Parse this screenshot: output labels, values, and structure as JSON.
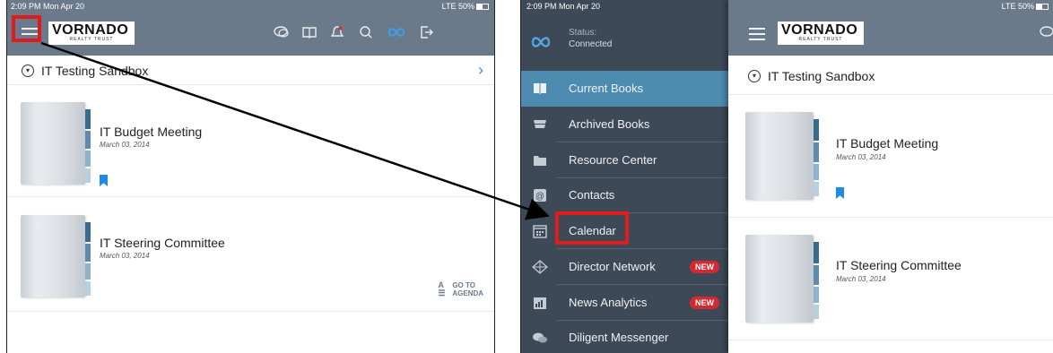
{
  "left_screen": {
    "status_bar": {
      "time": "2:09 PM  Mon Apr 20",
      "signal": "LTE 50%"
    },
    "header": {
      "logo_main": "VORNADO",
      "logo_sub": "REALTY TRUST"
    },
    "toolbar_icons": [
      "chat-icon",
      "book-icon",
      "bell-icon",
      "search-icon",
      "infinity-icon",
      "logout-icon"
    ],
    "sandbox": {
      "title": "IT Testing Sandbox"
    },
    "books": [
      {
        "title": "IT Budget Meeting",
        "date": "March 03, 2014",
        "bookmarked": true
      },
      {
        "title": "IT Steering Committee",
        "date": "March 03, 2014",
        "bookmarked": false,
        "goto": "GO TO",
        "agenda": "AGENDA"
      }
    ]
  },
  "right_screen": {
    "status_bar": {
      "time": "2:09 PM  Mon Apr 20",
      "signal": "LTE 50%"
    },
    "sidebar": {
      "status_label": "Status:",
      "status_value": "Connected",
      "items": [
        {
          "label": "Current Books",
          "icon": "book-icon",
          "active": true
        },
        {
          "label": "Archived Books",
          "icon": "archive-icon"
        },
        {
          "label": "Resource Center",
          "icon": "folder-icon"
        },
        {
          "label": "Contacts",
          "icon": "at-sign-icon"
        },
        {
          "label": "Calendar",
          "icon": "calendar-icon"
        },
        {
          "label": "Director Network",
          "icon": "network-icon",
          "badge": "NEW"
        },
        {
          "label": "News Analytics",
          "icon": "analytics-icon",
          "badge": "NEW"
        },
        {
          "label": "Diligent Messenger",
          "icon": "messenger-icon"
        }
      ]
    },
    "header": {
      "logo_main": "VORNADO",
      "logo_sub": "REALTY TRUST"
    },
    "sandbox": {
      "title": "IT Testing Sandbox"
    },
    "books": [
      {
        "title": "IT Budget Meeting",
        "date": "March 03, 2014",
        "bookmarked": true
      },
      {
        "title": "IT Steering Committee",
        "date": "March 03, 2014",
        "bookmarked": false
      }
    ]
  },
  "colors": {
    "header": "#6b7a8b",
    "sidebar": "#3d4957",
    "active": "#4e8bb1",
    "accent": "#1f8ae8",
    "highlight": "#e01b1b",
    "badge": "#d7282f"
  }
}
